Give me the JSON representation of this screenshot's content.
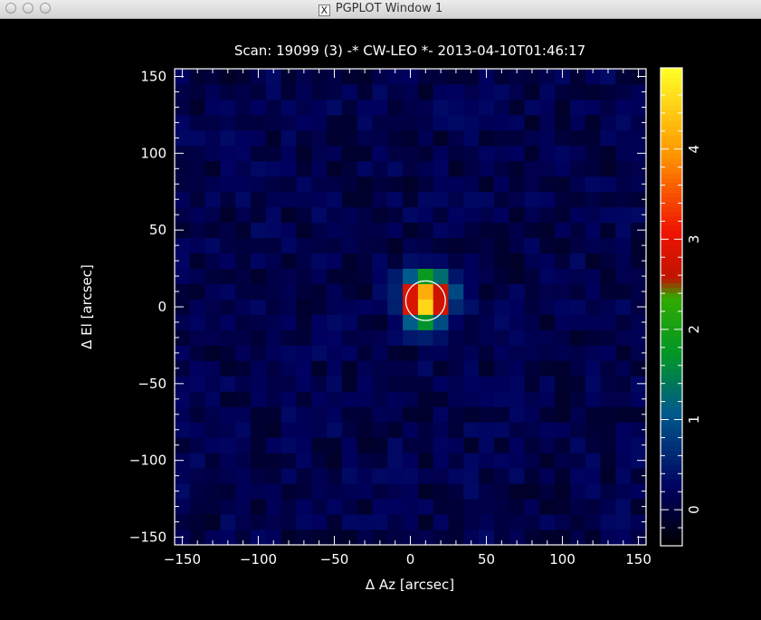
{
  "window": {
    "title": "PGPLOT Window 1",
    "app_icon": "x11-icon",
    "buttons": [
      "close-button",
      "minimize-button",
      "zoom-button"
    ]
  },
  "colors": {
    "background": "#000000",
    "axes": "#ffffff",
    "fit_circle": "#ffffff"
  },
  "chart_data": {
    "type": "heatmap",
    "title": "Scan: 19099 (3) -* CW-LEO *- 2013-04-10T01:46:17",
    "xlabel": "Δ Az [arcsec]",
    "ylabel": "Δ El [arcsec]",
    "xlim": [
      -155,
      155
    ],
    "ylim": [
      -155,
      155
    ],
    "xticks": [
      -150,
      -100,
      -50,
      0,
      50,
      100,
      150
    ],
    "yticks": [
      -150,
      -100,
      -50,
      0,
      50,
      100,
      150
    ],
    "pixel_size_arcsec": 10,
    "source": {
      "peak_az": 10,
      "peak_el": 5,
      "peak_value": 4.8,
      "fwhm_arcsec": 24
    },
    "background_level": 0.1,
    "fit_circle": {
      "center_az": 10,
      "center_el": 4,
      "radius_arcsec": 13
    },
    "colorbar": {
      "min": -0.4,
      "max": 4.9,
      "ticks": [
        0,
        1,
        2,
        3,
        4
      ],
      "colormap": "heat"
    },
    "grid": false
  }
}
